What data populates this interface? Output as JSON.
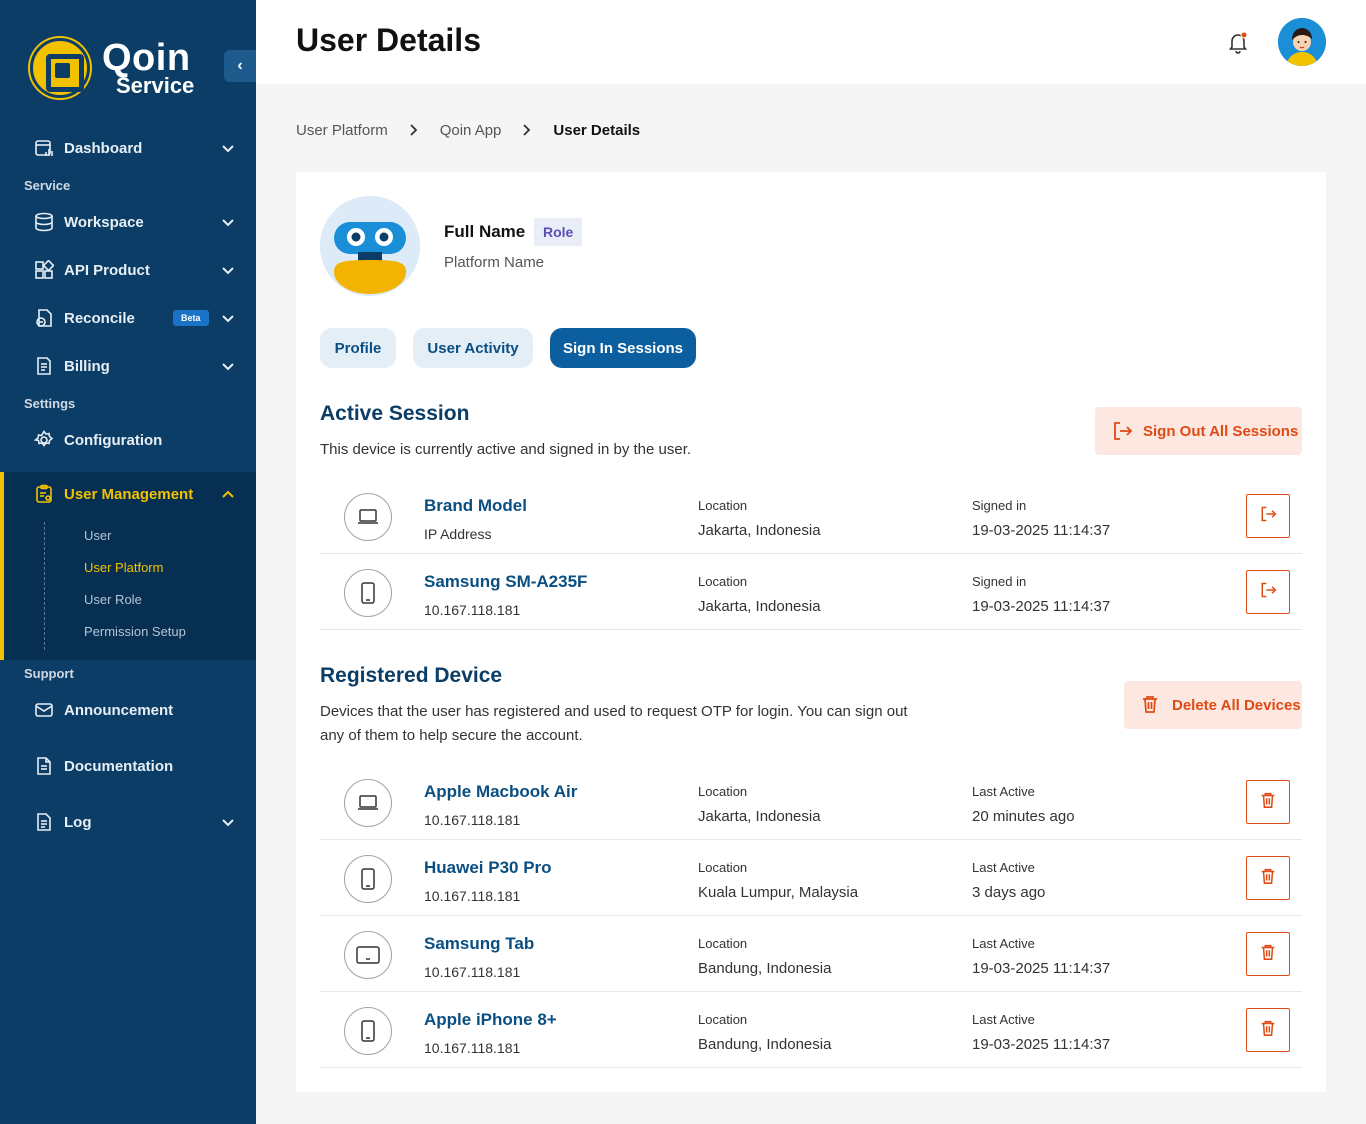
{
  "brand": {
    "name": "Qoin",
    "sub": "Service"
  },
  "sidebar": {
    "collapse_icon": "chevron-left-icon",
    "dashboard": "Dashboard",
    "section_service": "Service",
    "workspace": "Workspace",
    "api_product": "API Product",
    "reconcile": "Reconcile",
    "beta": "Beta",
    "billing": "Billing",
    "section_settings": "Settings",
    "configuration": "Configuration",
    "user_management": "User Management",
    "sub_items": [
      "User",
      "User Platform",
      "User Role",
      "Permission Setup"
    ],
    "active_sub_item": "User Platform",
    "section_support": "Support",
    "announcement": "Announcement",
    "documentation": "Documentation",
    "log": "Log"
  },
  "header": {
    "title": "User Details"
  },
  "breadcrumb": [
    "User Platform",
    "Qoin App",
    "User Details"
  ],
  "user": {
    "full_name": "Full Name",
    "role": "Role",
    "platform": "Platform Name"
  },
  "tabs": [
    "Profile",
    "User Activity",
    "Sign In Sessions"
  ],
  "active_tab": "Sign In Sessions",
  "active_session": {
    "title": "Active Session",
    "desc": "This device is currently active and signed in by the user.",
    "sign_out_all": "Sign Out All Sessions",
    "rows": [
      {
        "device": "laptop-icon",
        "name": "Brand Model",
        "sub": "IP Address",
        "loc_label": "Location",
        "location": "Jakarta, Indonesia",
        "time_label": "Signed in",
        "time": "19-03-2025 11:14:37"
      },
      {
        "device": "phone-icon",
        "name": "Samsung SM-A235F",
        "sub": "10.167.118.181",
        "loc_label": "Location",
        "location": "Jakarta, Indonesia",
        "time_label": "Signed in",
        "time": "19-03-2025 11:14:37"
      }
    ]
  },
  "registered_device": {
    "title": "Registered Device",
    "desc": "Devices that the user has registered and used to request OTP for login. You can sign out any of them to help secure the account.",
    "delete_all": "Delete All Devices",
    "rows": [
      {
        "device": "laptop-icon",
        "name": "Apple Macbook Air",
        "sub": "10.167.118.181",
        "loc_label": "Location",
        "location": "Jakarta, Indonesia",
        "time_label": "Last Active",
        "time": "20 minutes ago"
      },
      {
        "device": "phone-icon",
        "name": "Huawei P30 Pro",
        "sub": "10.167.118.181",
        "loc_label": "Location",
        "location": "Kuala Lumpur, Malaysia",
        "time_label": "Last Active",
        "time": "3 days ago"
      },
      {
        "device": "tablet-icon",
        "name": "Samsung Tab",
        "sub": "10.167.118.181",
        "loc_label": "Location",
        "location": "Bandung, Indonesia",
        "time_label": "Last Active",
        "time": "19-03-2025 11:14:37"
      },
      {
        "device": "phone-icon",
        "name": "Apple iPhone 8+",
        "sub": "10.167.118.181",
        "loc_label": "Location",
        "location": "Bandung, Indonesia",
        "time_label": "Last Active",
        "time": "19-03-2025 11:14:37"
      }
    ]
  },
  "colors": {
    "sidebar": "#0b3d66",
    "accent": "#f2c200",
    "primary": "#0b5f9e",
    "danger": "#e04a14"
  }
}
